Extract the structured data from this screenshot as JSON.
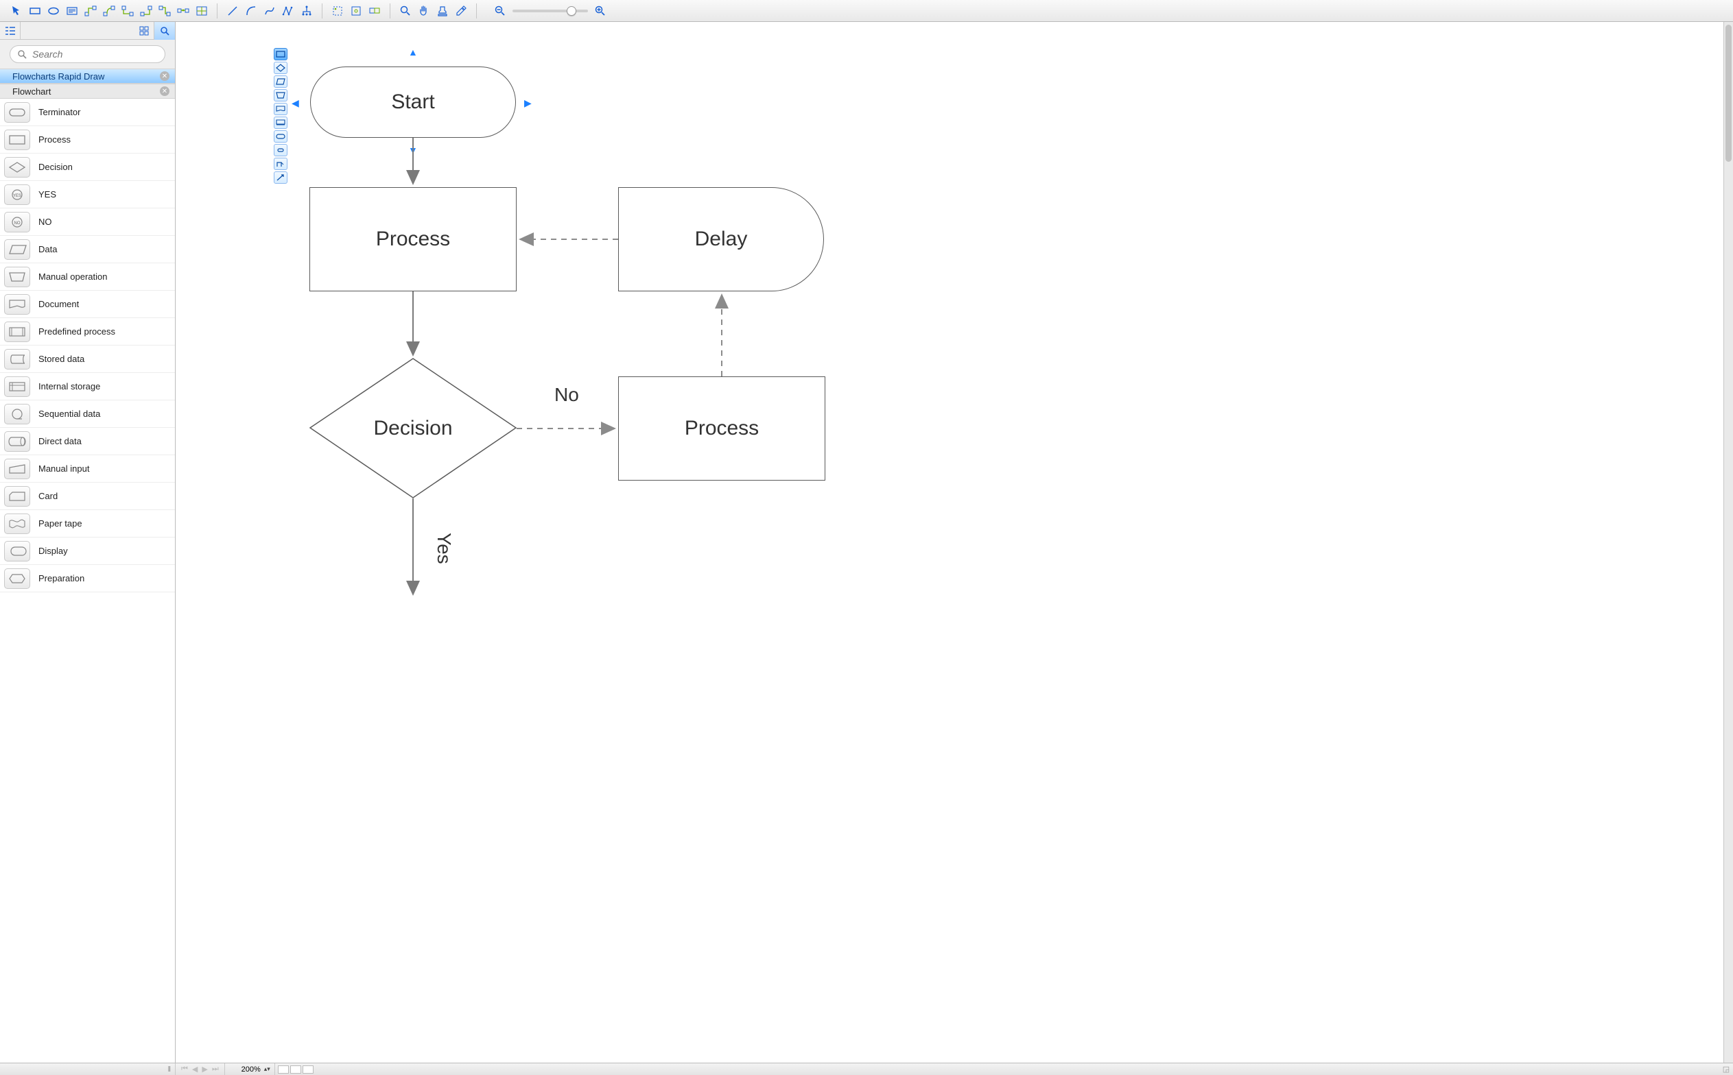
{
  "toolbar": {
    "tools1": [
      "pointer",
      "rect",
      "ellipse",
      "textbox",
      "connector-1",
      "connector-2",
      "connector-3",
      "connector-4",
      "connector-5",
      "connector-6",
      "connector-7"
    ],
    "tools2": [
      "curve-1",
      "curve-2",
      "curve-3",
      "segments",
      "tree"
    ],
    "tools3": [
      "group-1",
      "group-2",
      "group-3"
    ],
    "tools4": [
      "zoom-tool",
      "pan-tool",
      "stamp-tool",
      "eyedropper"
    ],
    "zoom": {
      "out": "zoom-out",
      "in": "zoom-in",
      "value": 72
    }
  },
  "sidebar": {
    "tree_btn": "tree",
    "grid_btn": "grid",
    "search_btn": "search",
    "search_placeholder": "Search",
    "categories": [
      {
        "label": "Flowcharts Rapid Draw",
        "selected": true
      },
      {
        "label": "Flowchart",
        "selected": false
      }
    ],
    "shapes": [
      {
        "label": "Terminator",
        "shape": "terminator"
      },
      {
        "label": "Process",
        "shape": "process"
      },
      {
        "label": "Decision",
        "shape": "decision"
      },
      {
        "label": "YES",
        "shape": "yes"
      },
      {
        "label": "NO",
        "shape": "no"
      },
      {
        "label": "Data",
        "shape": "data"
      },
      {
        "label": "Manual operation",
        "shape": "manualop"
      },
      {
        "label": "Document",
        "shape": "document"
      },
      {
        "label": "Predefined process",
        "shape": "predef"
      },
      {
        "label": "Stored data",
        "shape": "stored"
      },
      {
        "label": "Internal storage",
        "shape": "internal"
      },
      {
        "label": "Sequential data",
        "shape": "seq"
      },
      {
        "label": "Direct data",
        "shape": "direct"
      },
      {
        "label": "Manual input",
        "shape": "manin"
      },
      {
        "label": "Card",
        "shape": "card"
      },
      {
        "label": "Paper tape",
        "shape": "tape"
      },
      {
        "label": "Display",
        "shape": "display"
      },
      {
        "label": "Preparation",
        "shape": "prep"
      }
    ]
  },
  "canvas": {
    "nodes": {
      "start": {
        "label": "Start",
        "type": "terminator",
        "selected": true
      },
      "process1": {
        "label": "Process",
        "type": "process"
      },
      "decision": {
        "label": "Decision",
        "type": "decision"
      },
      "delay": {
        "label": "Delay",
        "type": "delay"
      },
      "process2": {
        "label": "Process",
        "type": "process"
      }
    },
    "edges": [
      {
        "from": "start",
        "to": "process1",
        "style": "solid"
      },
      {
        "from": "process1",
        "to": "decision",
        "style": "solid"
      },
      {
        "from": "decision",
        "to": "process2",
        "style": "dashed",
        "label": "No"
      },
      {
        "from": "decision",
        "to": "down",
        "style": "solid",
        "label": "Yes"
      },
      {
        "from": "process2",
        "to": "delay",
        "style": "dashed"
      },
      {
        "from": "delay",
        "to": "process1",
        "style": "dashed"
      }
    ],
    "rapid_draw_palette": [
      "process",
      "decision",
      "data",
      "manualop",
      "document",
      "predef",
      "display",
      "terminator",
      "offpage",
      "connector",
      "arrow"
    ]
  },
  "statusbar": {
    "zoom_text": "200%"
  }
}
